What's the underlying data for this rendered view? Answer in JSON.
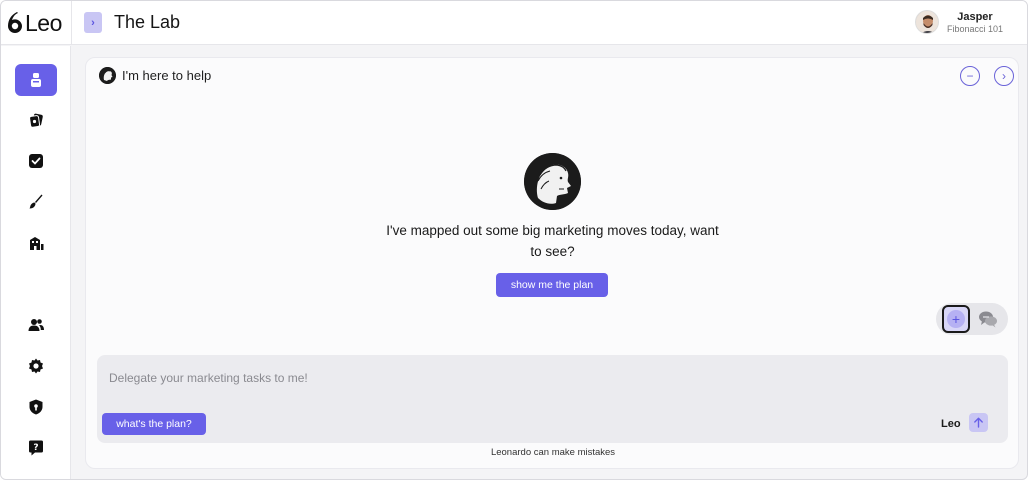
{
  "app": {
    "logo_text": "Leo",
    "title": "The Lab"
  },
  "user": {
    "name": "Jasper",
    "subtitle": "Fibonacci 101"
  },
  "sidebar": {
    "items": [
      {
        "icon": "agent-icon",
        "active": true
      },
      {
        "icon": "cards-icon",
        "active": false
      },
      {
        "icon": "checkbox-icon",
        "active": false
      },
      {
        "icon": "brush-icon",
        "active": false
      },
      {
        "icon": "building-icon",
        "active": false
      },
      {
        "icon": "users-icon",
        "active": false
      },
      {
        "icon": "gear-icon",
        "active": false
      },
      {
        "icon": "shield-icon",
        "active": false
      },
      {
        "icon": "help-icon",
        "active": false
      }
    ]
  },
  "chat": {
    "header_text": "I'm here to help",
    "message": "I've mapped out some big marketing moves today, want to see?",
    "primary_action": "show me the plan",
    "input_placeholder": "Delegate your marketing tasks to me!",
    "quick_action": "what's the plan?",
    "model_label": "Leo",
    "disclaimer": "Leonardo can make mistakes"
  },
  "colors": {
    "accent": "#6860e8",
    "accent_light": "#c9c6f4",
    "background": "#f4f4f6"
  }
}
